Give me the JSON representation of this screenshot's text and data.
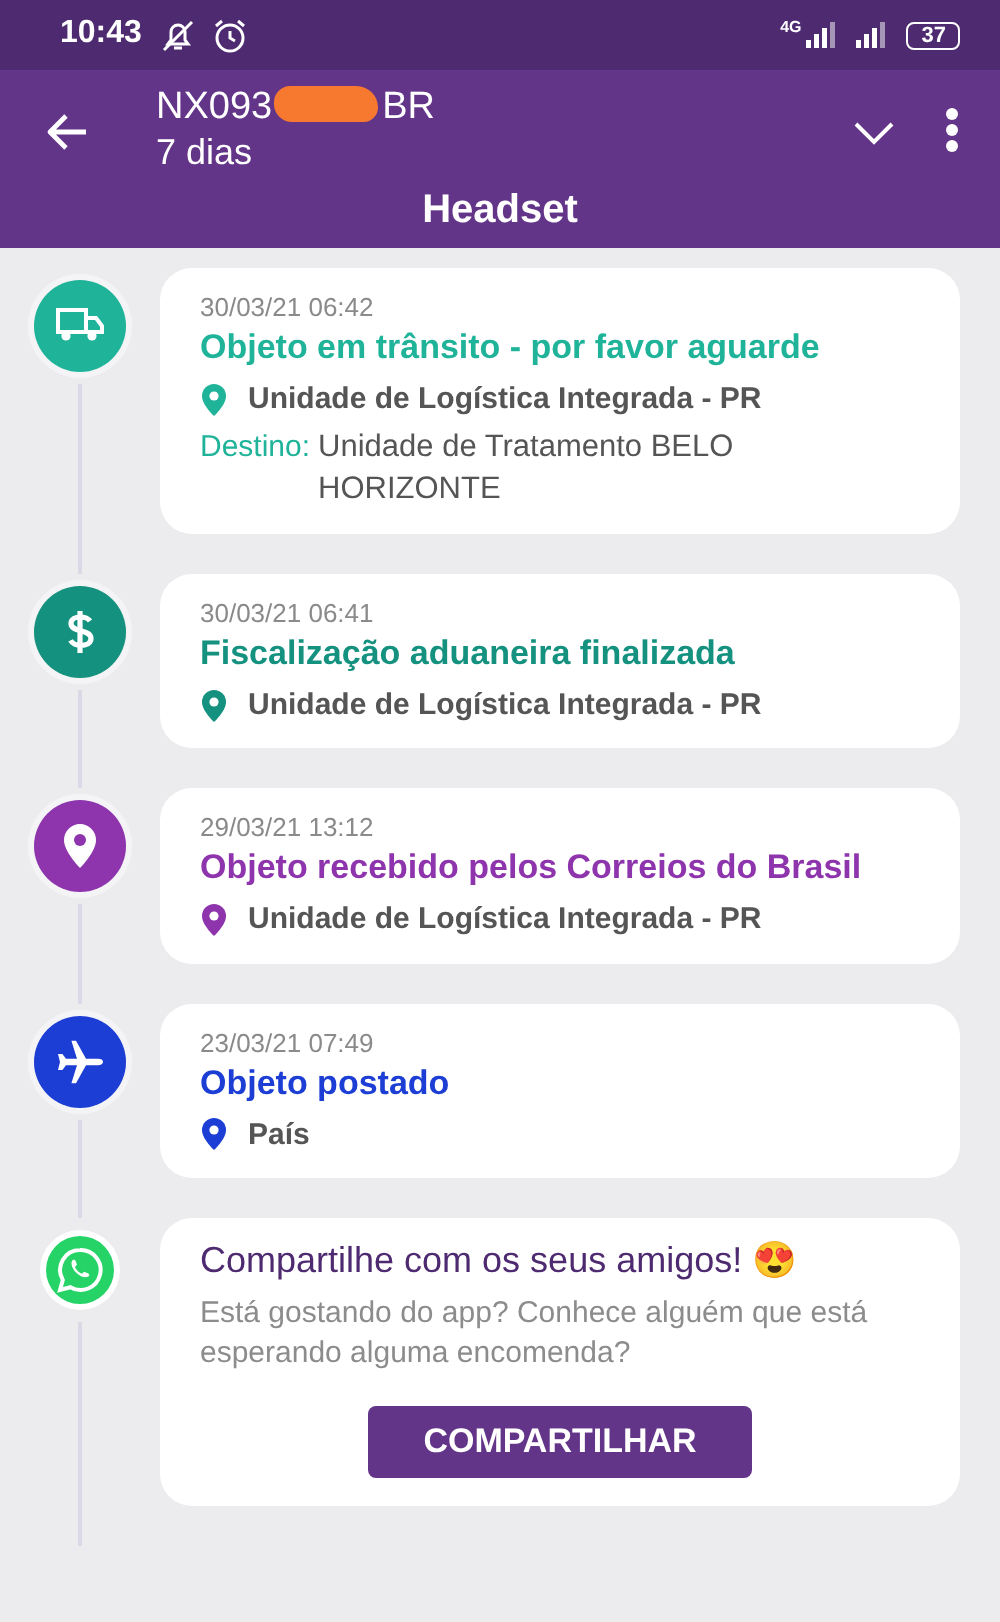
{
  "status_bar": {
    "time": "10:43",
    "network": "4G",
    "battery": "37"
  },
  "header": {
    "code_start": "NX093",
    "code_end": "BR",
    "code_redacted": true,
    "subtitle": "7 dias",
    "title": "Headset"
  },
  "events": [
    {
      "kind": "truck",
      "color": "#1fb39a",
      "date": "30/03/21 06:42",
      "title": "Objeto em trânsito - por favor aguarde",
      "location": "Unidade de Logística Integrada - PR",
      "destination_label": "Destino:",
      "destination": "Unidade de Tratamento BELO HORIZONTE"
    },
    {
      "kind": "dollar",
      "color": "#14917f",
      "date": "30/03/21 06:41",
      "title": "Fiscalização aduaneira finalizada",
      "location": "Unidade de Logística Integrada - PR"
    },
    {
      "kind": "pin",
      "color": "#8e35ad",
      "date": "29/03/21 13:12",
      "title": "Objeto recebido pelos Correios do Brasil",
      "location": "Unidade de Logística Integrada - PR"
    },
    {
      "kind": "plane",
      "color": "#1c3ed4",
      "date": "23/03/21 07:49",
      "title": "Objeto postado",
      "location": "País"
    }
  ],
  "share": {
    "title": "Compartilhe com os seus amigos!",
    "emoji": "😍",
    "text": "Está gostando do app? Conhece alguém que está esperando alguma encomenda?",
    "button": "COMPARTILHAR"
  }
}
